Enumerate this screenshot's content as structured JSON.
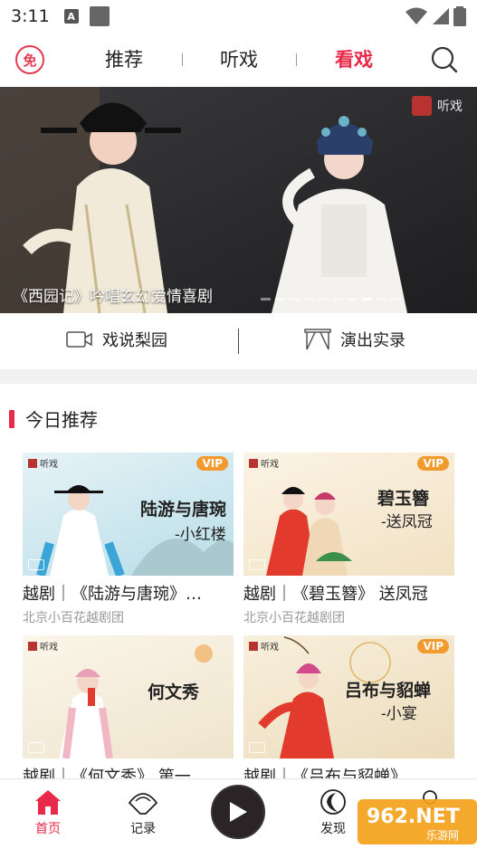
{
  "status_bar": {
    "time": "3:11",
    "a_badge": "A"
  },
  "top_nav": {
    "logo_text": "免",
    "tabs": [
      {
        "label": "推荐",
        "active": false
      },
      {
        "label": "听戏",
        "active": false
      },
      {
        "label": "看戏",
        "active": true
      }
    ]
  },
  "banner": {
    "caption": "《西园记》吟唱玄幻爱情喜剧",
    "brand": "听戏",
    "dot_count": 10,
    "active_dot": 7
  },
  "sub_nav": [
    {
      "label": "戏说梨园",
      "icon": "video-camera-icon"
    },
    {
      "label": "演出实录",
      "icon": "stage-curtain-icon"
    }
  ],
  "section": {
    "title": "今日推荐"
  },
  "cards": [
    {
      "title": "越剧｜《陆游与唐琬》…",
      "org": "北京小百花越剧团",
      "vip": "VIP",
      "thumb_title": "陆游与唐琬",
      "thumb_sub": "-小红楼",
      "thumb_brand": "听戏"
    },
    {
      "title": "越剧｜《碧玉簪》 送凤冠",
      "org": "北京小百花越剧团",
      "vip": "VIP",
      "thumb_title": "碧玉簪",
      "thumb_sub": "-送凤冠",
      "thumb_brand": "听戏"
    },
    {
      "title": "越剧｜《何文秀》 第一",
      "org": "",
      "vip": "",
      "thumb_title": "何文秀",
      "thumb_sub": "",
      "thumb_brand": "听戏"
    },
    {
      "title": "越剧｜《吕布与貂蝉》",
      "org": "",
      "vip": "VIP",
      "thumb_title": "吕布与貂蝉",
      "thumb_sub": "-小宴",
      "thumb_brand": "听戏"
    }
  ],
  "bottom_nav": [
    {
      "label": "首页",
      "icon": "home-icon",
      "active": true
    },
    {
      "label": "记录",
      "icon": "fan-icon",
      "active": false
    },
    {
      "label": "发现",
      "icon": "moon-icon",
      "active": false
    },
    {
      "label": "",
      "icon": "person-icon",
      "active": false
    }
  ],
  "watermark": {
    "text": "962.NET",
    "sub": "乐游网"
  },
  "colors": {
    "accent": "#e8294a",
    "vip": "#f29a2e"
  }
}
